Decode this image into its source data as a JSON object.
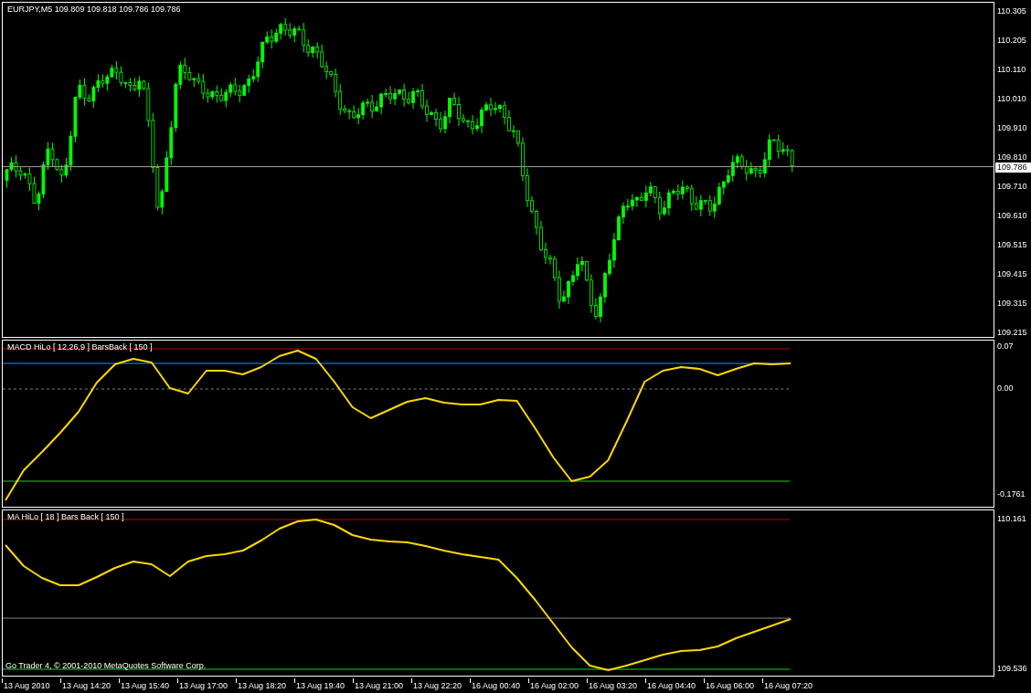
{
  "main_chart": {
    "header": "EURJPY,M5  109.809 109.818 109.786 109.786",
    "price_axis": [
      "110.305",
      "110.205",
      "110.110",
      "110.010",
      "109.910",
      "109.810",
      "109.710",
      "109.610",
      "109.515",
      "109.415",
      "109.315",
      "109.215"
    ],
    "current_price": "109.786"
  },
  "indicators": [
    {
      "kind": "macd",
      "label": "MACD HiLo [ 12,26,9 ] BarsBack [ 150 ]",
      "axis_labels": [
        "0.07",
        "0.00",
        "-0.1761"
      ]
    },
    {
      "kind": "ma",
      "label": "MA HiLo [ 18 ] Bars Back [ 150 ]",
      "footer": "Go Trader 4, © 2001-2010 MetaQuotes Software Corp.",
      "axis_labels": [
        "110.161",
        "109.536"
      ]
    }
  ],
  "time_axis": [
    "13 Aug 2010",
    "13 Aug 14:20",
    "13 Aug 15:40",
    "13 Aug 17:00",
    "13 Aug 18:20",
    "13 Aug 19:40",
    "13 Aug 21:00",
    "13 Aug 22:20",
    "16 Aug 00:40",
    "16 Aug 02:00",
    "16 Aug 03:20",
    "16 Aug 04:40",
    "16 Aug 06:00",
    "16 Aug 07:20"
  ]
}
